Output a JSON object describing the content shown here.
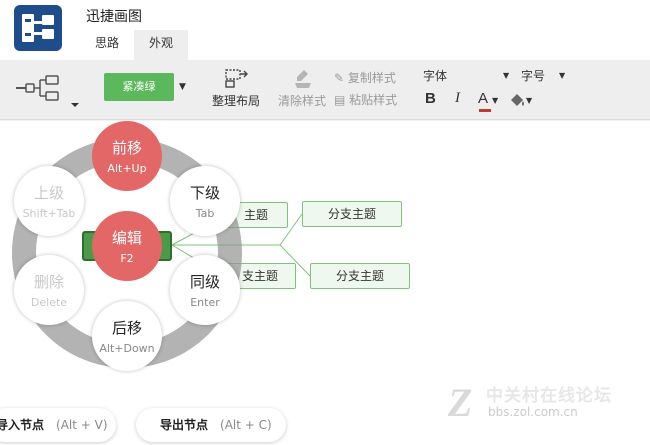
{
  "app": {
    "title": "迅捷画图"
  },
  "tabs": [
    {
      "label": "思路"
    },
    {
      "label": "外观"
    }
  ],
  "toolbar": {
    "theme_button": "紧凑绿",
    "arrange": "整理布局",
    "clear_style": "清除样式",
    "copy_style": "复制样式",
    "paste_style": "粘贴样式",
    "font_label": "字体",
    "size_label": "字号",
    "bold": "B",
    "italic": "I",
    "font_color": "A"
  },
  "canvas": {
    "topics": [
      "主题",
      "分支主题",
      "支主题",
      "分支主题"
    ]
  },
  "radial_menu": {
    "forward": {
      "label": "前移",
      "key": "Alt+Up"
    },
    "down": {
      "label": "下级",
      "key": "Tab"
    },
    "same": {
      "label": "同级",
      "key": "Enter"
    },
    "back": {
      "label": "后移",
      "key": "Alt+Down"
    },
    "delete": {
      "label": "删除",
      "key": "Delete"
    },
    "up": {
      "label": "上级",
      "key": "Shift+Tab"
    },
    "edit": {
      "label": "编辑",
      "key": "F2"
    }
  },
  "bottom_actions": {
    "import": {
      "label": "导入节点",
      "key": "(Alt + V)"
    },
    "export": {
      "label": "导出节点",
      "key": "(Alt + C)"
    }
  },
  "watermark": {
    "title": "中关村在线论坛",
    "url": "bbs.zol.com.cn",
    "mark": "Z"
  },
  "colors": {
    "accent_green": "#5cb85c",
    "menu_red": "#e46767",
    "logo_blue": "#1f4d8c"
  }
}
